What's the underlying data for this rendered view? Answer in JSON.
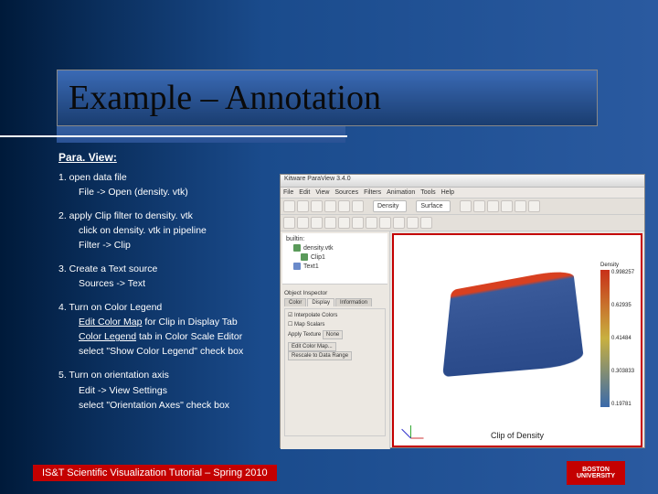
{
  "title": "Example – Annotation",
  "heading": "Para. View:",
  "steps": {
    "s1": "1. open data file",
    "s1a": "File -> Open (density. vtk)",
    "s2": "2. apply Clip filter to density. vtk",
    "s2a": "click on density. vtk in pipeline",
    "s2b": "Filter -> Clip",
    "s3": "3. Create a Text source",
    "s3a": "Sources -> Text",
    "s4": "4. Turn on Color Legend",
    "s4a_u": "Edit Color Map",
    "s4a_rest": " for Clip in Display Tab",
    "s4b_u": "Color Legend",
    "s4b_rest": " tab in Color Scale Editor",
    "s4c": "select \"Show Color Legend\" check box",
    "s5": "5. Turn on orientation axis",
    "s5a": "Edit -> View Settings",
    "s5b": "select \"Orientation Axes\" check box"
  },
  "paraview": {
    "window_title": "Kitware ParaView 3.4.0",
    "menus": [
      "File",
      "Edit",
      "View",
      "Sources",
      "Filters",
      "Animation",
      "Tools",
      "Help"
    ],
    "combo_density": "Density",
    "combo_repr": "Surface",
    "pipeline": {
      "root": "builtin:",
      "items": [
        "density.vtk",
        "Clip1",
        "Text1"
      ]
    },
    "inspector": {
      "title": "Object Inspector",
      "tabs": [
        "Color",
        "Display",
        "Information"
      ],
      "interp": "Interpolate Colors",
      "map": "Map Scalars",
      "apply_tex": "Apply Texture",
      "none": "None",
      "btn1": "Edit Color Map...",
      "btn2": "Rescale to Data Range"
    },
    "caption": "Clip of Density",
    "legend": {
      "title": "Density",
      "ticks": [
        "0.998257",
        "0.62935",
        "0.41484",
        "0.303833",
        "0.19781"
      ]
    }
  },
  "footer": "IS&T Scientific Visualization Tutorial – Spring 2010",
  "logo": "BOSTON UNIVERSITY"
}
